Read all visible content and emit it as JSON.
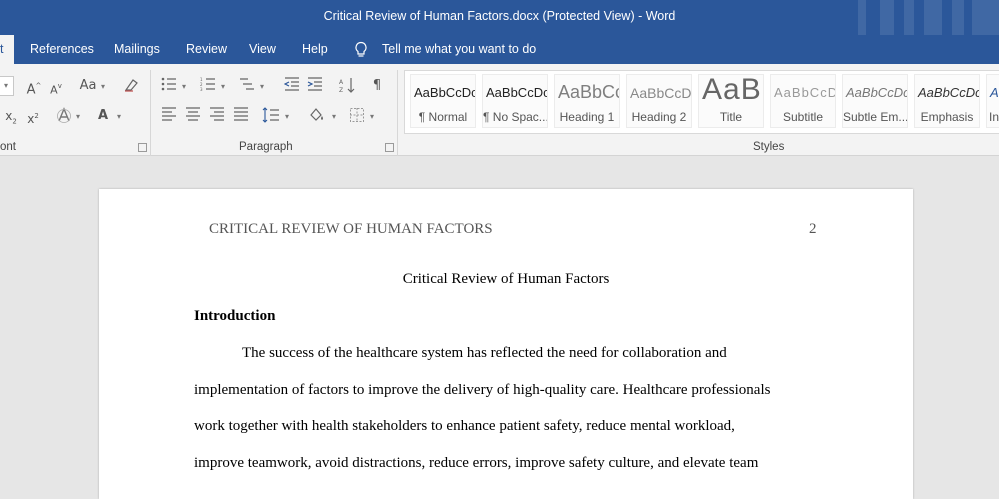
{
  "title_bar": {
    "title": "Critical Review of Human Factors.docx (Protected View)  -  Word"
  },
  "tabs": [
    {
      "label": "t"
    },
    {
      "label": "References"
    },
    {
      "label": "Mailings"
    },
    {
      "label": "Review"
    },
    {
      "label": "View"
    },
    {
      "label": "Help"
    }
  ],
  "tell_me": "Tell me what you want to do",
  "ribbon": {
    "font_group": "ont",
    "paragraph_group": "Paragraph",
    "styles_group": "Styles",
    "styles": [
      {
        "sample": "AaBbCcDc",
        "name": "¶ Normal"
      },
      {
        "sample": "AaBbCcDc",
        "name": "¶ No Spac..."
      },
      {
        "sample": "AaBbCc",
        "name": "Heading 1"
      },
      {
        "sample": "AaBbCcD",
        "name": "Heading 2"
      },
      {
        "sample": "AaB",
        "name": "Title"
      },
      {
        "sample": "AaBbCcD",
        "name": "Subtitle"
      },
      {
        "sample": "AaBbCcDc",
        "name": "Subtle Em..."
      },
      {
        "sample": "AaBbCcDc",
        "name": "Emphasis"
      },
      {
        "sample": "A",
        "name": "In"
      }
    ]
  },
  "document": {
    "running_head": "CRITICAL REVIEW OF HUMAN FACTORS",
    "page_number": "2",
    "title": "Critical Review of Human Factors",
    "heading": "Introduction",
    "lines": [
      "The success of the healthcare system has reflected the need for collaboration and",
      "implementation of factors to improve the delivery of high-quality care. Healthcare professionals",
      "work together with health stakeholders to enhance patient safety, reduce mental workload,",
      "improve teamwork, avoid distractions, reduce errors, improve safety culture, and elevate team"
    ]
  },
  "colors": {
    "word_blue": "#2b579a",
    "ribbon_bg": "#f3f3f3",
    "workspace_bg": "#e6e6e6"
  }
}
